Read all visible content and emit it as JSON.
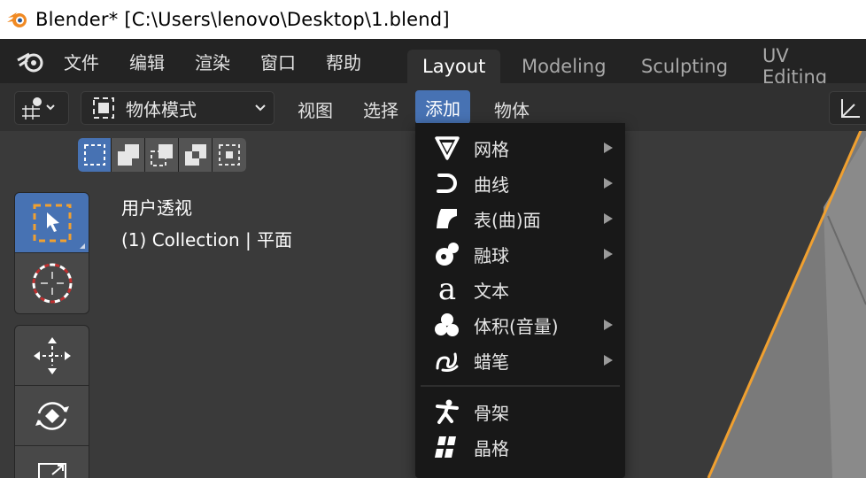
{
  "window": {
    "title": "Blender* [C:\\Users\\lenovo\\Desktop\\1.blend]"
  },
  "topbar": {
    "menus": [
      "文件",
      "编辑",
      "渲染",
      "窗口",
      "帮助"
    ],
    "workspaces": [
      "Layout",
      "Modeling",
      "Sculpting",
      "UV Editing"
    ],
    "active_workspace": "Layout"
  },
  "viewport_header": {
    "mode": "物体模式",
    "menus": [
      "视图",
      "选择",
      "添加",
      "物体"
    ],
    "active_menu": "添加"
  },
  "overlay": {
    "view_name": "用户透视",
    "collection_info": "(1) Collection | 平面"
  },
  "add_menu": {
    "items": [
      {
        "label": "网格",
        "icon": "mesh-icon",
        "has_submenu": true
      },
      {
        "label": "曲线",
        "icon": "curve-icon",
        "has_submenu": true
      },
      {
        "label": "表(曲)面",
        "icon": "surface-icon",
        "has_submenu": true
      },
      {
        "label": "融球",
        "icon": "metaball-icon",
        "has_submenu": true
      },
      {
        "label": "文本",
        "icon": "text-icon",
        "has_submenu": false
      },
      {
        "label": "体积(音量)",
        "icon": "volume-icon",
        "has_submenu": true
      },
      {
        "label": "蜡笔",
        "icon": "grease-pencil-icon",
        "has_submenu": true
      },
      {
        "label": "骨架",
        "icon": "armature-icon",
        "has_submenu": false
      },
      {
        "label": "晶格",
        "icon": "lattice-icon",
        "has_submenu": false
      }
    ]
  },
  "colors": {
    "accent": "#4772b3",
    "selection_outline": "#f0a030",
    "topbar_bg": "#232323",
    "viewport_bg": "#3a3a3a"
  }
}
